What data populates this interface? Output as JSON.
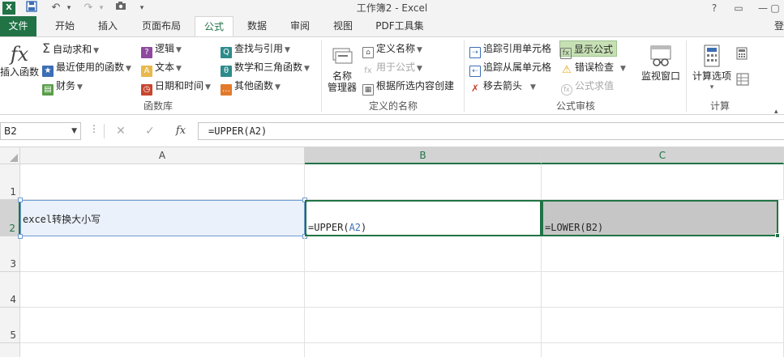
{
  "window": {
    "title": "工作簿2 - Excel",
    "logo": "X",
    "controls": [
      "?",
      "▭",
      "—",
      "▢",
      "✕"
    ]
  },
  "quick_access": {
    "save": "💾",
    "undo": "↶",
    "redo": "↷",
    "camera": "📷",
    "more": "▾"
  },
  "tabs": [
    "文件",
    "开始",
    "插入",
    "页面布局",
    "公式",
    "数据",
    "审阅",
    "视图",
    "PDF工具集"
  ],
  "active_tab": "公式",
  "login_label": "登",
  "ribbon": {
    "function_library": {
      "insert_function": "插入函数",
      "insert_function_icon": "fx",
      "autosum": "自动求和",
      "recent": "最近使用的函数",
      "financial": "财务",
      "logical": "逻辑",
      "text": "文本",
      "datetime": "日期和时间",
      "lookup": "查找与引用",
      "math": "数学和三角函数",
      "more": "其他函数",
      "label": "函数库"
    },
    "defined_names": {
      "name_manager_line1": "名称",
      "name_manager_line2": "管理器",
      "define_name": "定义名称",
      "use_in_formula": "用于公式",
      "create_from_selection": "根据所选内容创建",
      "label": "定义的名称"
    },
    "formula_auditing": {
      "trace_precedents": "追踪引用单元格",
      "trace_dependents": "追踪从属单元格",
      "remove_arrows": "移去箭头",
      "show_formulas": "显示公式",
      "error_checking": "错误检查",
      "evaluate_formula": "公式求值",
      "watch_window": "监视窗口",
      "label": "公式审核"
    },
    "calculation": {
      "options_line1": "计算选项",
      "options_caret": "▾",
      "label": "计算"
    }
  },
  "formula_bar": {
    "name_box": "B2",
    "cancel": "✕",
    "enter": "✓",
    "fx": "fx",
    "content": "=UPPER(A2)"
  },
  "grid": {
    "columns": [
      "A",
      "B",
      "C"
    ],
    "rows": [
      "1",
      "2",
      "3",
      "4",
      "5"
    ],
    "cells": {
      "A2": "excel转换大小写",
      "B2_prefix": "=UPPER(",
      "B2_ref": "A2",
      "B2_suffix": ")",
      "C2": "=LOWER(B2)"
    }
  },
  "colors": {
    "accent": "#217346",
    "ref_blue": "#3c6eb4",
    "show_formulas_highlight": "#c6e0b4"
  }
}
